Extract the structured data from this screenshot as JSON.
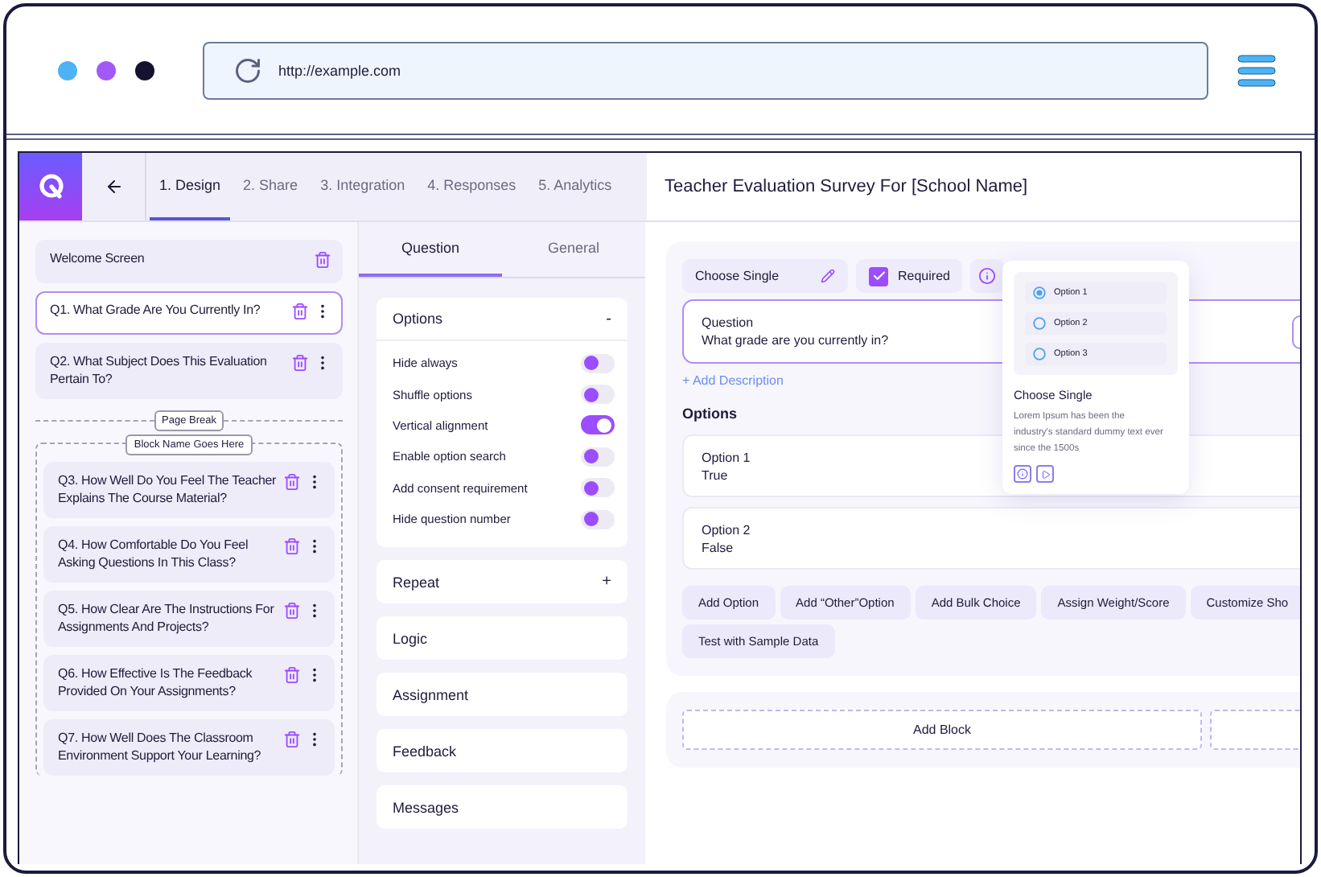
{
  "browser": {
    "url": "http://example.com"
  },
  "nav": {
    "tabs": [
      {
        "label": "1. Design",
        "selected": true
      },
      {
        "label": "2. Share",
        "selected": false
      },
      {
        "label": "3. Integration",
        "selected": false
      },
      {
        "label": "4. Responses",
        "selected": false
      },
      {
        "label": "5. Analytics",
        "selected": false
      }
    ]
  },
  "title": "Teacher Evaluation Survey For [School Name]",
  "sidebar": {
    "items": [
      {
        "kind": "screen",
        "label": "Welcome Screen",
        "selected": false
      },
      {
        "kind": "question",
        "label": "Q1. What Grade Are You Currently In?",
        "selected": true
      },
      {
        "kind": "question",
        "label": "Q2. What Subject Does This Evaluation Pertain To?",
        "selected": false
      },
      {
        "kind": "page_break",
        "label": "Page Break"
      },
      {
        "kind": "block",
        "label": "Block Name Goes Here",
        "children": [
          {
            "kind": "question",
            "label": "Q3. How Well Do You Feel The Teacher Explains The Course Material?",
            "selected": false
          },
          {
            "kind": "question",
            "label": "Q4. How Comfortable Do You Feel Asking Questions In This Class?",
            "selected": false
          },
          {
            "kind": "question",
            "label": "Q5. How Clear Are The Instructions For Assignments And Projects?",
            "selected": false
          },
          {
            "kind": "question",
            "label": "Q6. How Effective Is The Feedback Provided On Your Assignments?",
            "selected": false
          },
          {
            "kind": "question",
            "label": "Q7. How Well Does The Classroom Environment Support Your Learning?",
            "selected": false
          }
        ]
      }
    ]
  },
  "settings": {
    "tabs": [
      {
        "label": "Question",
        "selected": true
      },
      {
        "label": "General",
        "selected": false
      }
    ],
    "sections": [
      {
        "title": "Options",
        "symbol": "-",
        "toggles": [
          {
            "label": "Hide always",
            "on": false
          },
          {
            "label": "Shuffle options",
            "on": false
          },
          {
            "label": "Vertical alignment",
            "on": true
          },
          {
            "label": "Enable option search",
            "on": false
          },
          {
            "label": "Add consent requirement",
            "on": false
          },
          {
            "label": "Hide question number",
            "on": false
          }
        ]
      },
      {
        "title": "Repeat",
        "symbol": "+"
      },
      {
        "title": "Logic"
      },
      {
        "title": "Assignment"
      },
      {
        "title": "Feedback"
      },
      {
        "title": "Messages"
      }
    ]
  },
  "question": {
    "type_label": "Choose Single",
    "required": {
      "label": "Required",
      "checked": true
    },
    "field_label": "Question",
    "field_value": "What grade are you currently in?",
    "add_description": "+ Add Description",
    "options_heading": "Options",
    "options": [
      {
        "label": "Option 1",
        "value": "True"
      },
      {
        "label": "Option 2",
        "value": "False"
      }
    ],
    "actions": [
      "Add Option",
      "Add “Other”Option",
      "Add Bulk Choice",
      "Assign Weight/Score",
      "Customize Sho",
      "Test with Sample Data"
    ],
    "add_block": "Add Block"
  },
  "popup": {
    "options": [
      {
        "label": "Option 1",
        "selected": true
      },
      {
        "label": "Option 2",
        "selected": false
      },
      {
        "label": "Option 3",
        "selected": false
      }
    ],
    "title": "Choose Single",
    "text": "Lorem Ipsum has been the industry's standard dummy text ever since the 1500s"
  }
}
